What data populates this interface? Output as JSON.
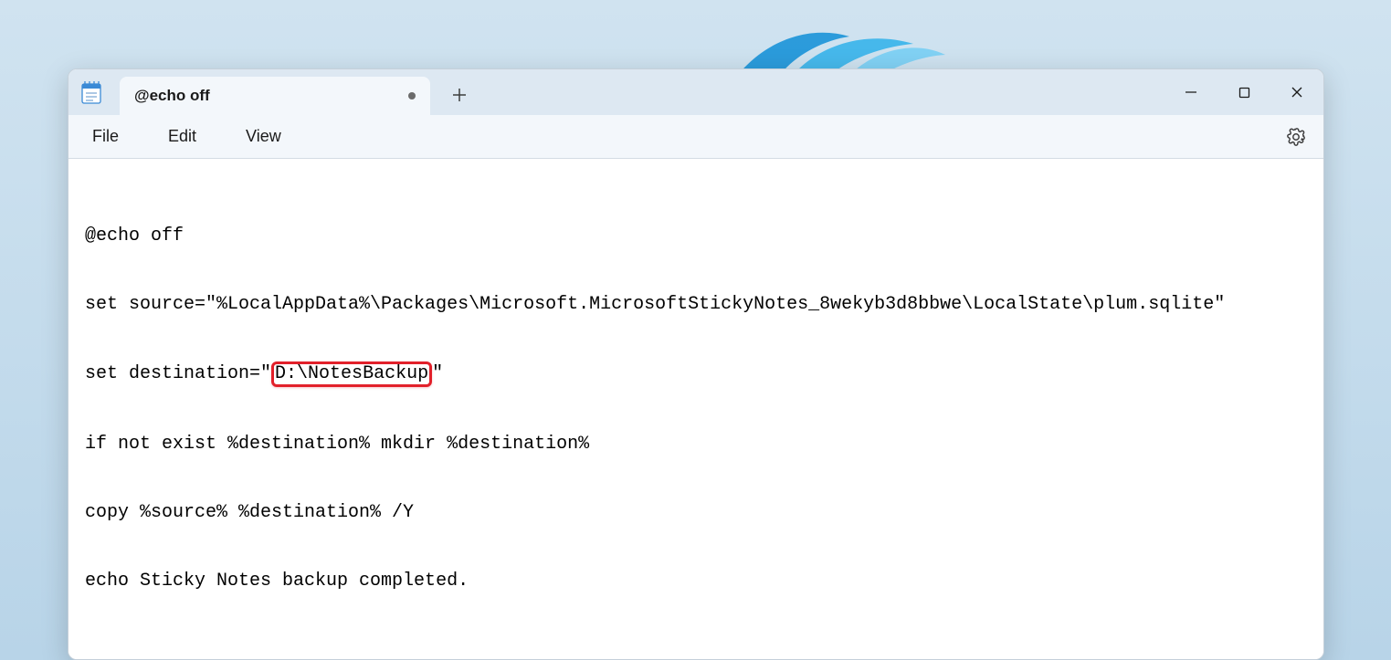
{
  "tab": {
    "title": "@echo off",
    "modified": true
  },
  "menu": {
    "file": "File",
    "edit": "Edit",
    "view": "View"
  },
  "editor": {
    "line1": "@echo off",
    "line2": "set source=\"%LocalAppData%\\Packages\\Microsoft.MicrosoftStickyNotes_8wekyb3d8bbwe\\LocalState\\plum.sqlite\"",
    "line3_prefix": "set destination=\"",
    "line3_highlight": "D:\\NotesBackup",
    "line3_suffix": "\"",
    "line4": "if not exist %destination% mkdir %destination%",
    "line5": "copy %source% %destination% /Y",
    "line6": "echo Sticky Notes backup completed."
  }
}
